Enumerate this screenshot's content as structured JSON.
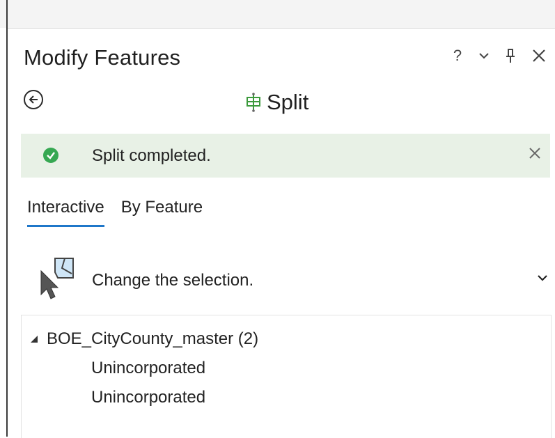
{
  "pane": {
    "title": "Modify Features",
    "controls": {
      "help_label": "?"
    }
  },
  "tool": {
    "title": "Split"
  },
  "message": {
    "text": "Split completed.",
    "status_color": "#36a852"
  },
  "tabs": [
    {
      "label": "Interactive",
      "active": true
    },
    {
      "label": "By Feature",
      "active": false
    }
  ],
  "selection": {
    "label": "Change the selection."
  },
  "tree": {
    "layer": "BOE_CityCounty_master (2)",
    "features": [
      "Unincorporated",
      "Unincorporated"
    ]
  },
  "colors": {
    "accent": "#1f77c9",
    "message_bg": "#e8f1e6"
  }
}
